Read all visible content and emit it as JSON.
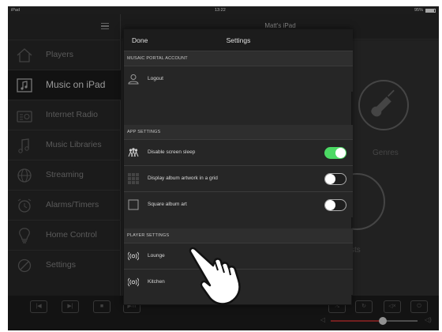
{
  "status_bar": {
    "carrier": "iPad",
    "time": "13:22",
    "battery": "95%"
  },
  "header": {
    "device_title": "Matt's iPad"
  },
  "sidebar": {
    "items": [
      {
        "label": "Players",
        "icon": "house-icon",
        "active": false
      },
      {
        "label": "Music on iPad",
        "icon": "music-note-icon",
        "active": true
      },
      {
        "label": "Internet Radio",
        "icon": "radio-icon",
        "active": false
      },
      {
        "label": "Music Libraries",
        "icon": "music-library-icon",
        "active": false
      },
      {
        "label": "Streaming",
        "icon": "globe-icon",
        "active": false
      },
      {
        "label": "Alarms/Timers",
        "icon": "alarm-clock-icon",
        "active": false
      },
      {
        "label": "Home Control",
        "icon": "lightbulb-icon",
        "active": false
      },
      {
        "label": "Settings",
        "icon": "gear-icon",
        "active": false
      }
    ]
  },
  "content": {
    "tiles": [
      {
        "label": "Genres",
        "icon": "guitar-icon"
      },
      {
        "label": "sts",
        "icon": "house-icon"
      }
    ]
  },
  "settings": {
    "done_label": "Done",
    "title": "Settings",
    "sections": [
      {
        "header": "MUSAIC PORTAL ACCOUNT",
        "rows": [
          {
            "label": "Logout",
            "icon": "user-icon"
          }
        ]
      },
      {
        "header": "APP SETTINGS",
        "rows": [
          {
            "label": "Disable screen sleep",
            "icon": "people-icon",
            "toggle": true
          },
          {
            "label": "Display album artwork in a grid",
            "icon": "grid-icon",
            "toggle": false
          },
          {
            "label": "Square album art",
            "icon": "square-icon",
            "toggle": false
          }
        ]
      },
      {
        "header": "PLAYER SETTINGS",
        "rows": [
          {
            "label": "Lounge",
            "icon": "speaker-icon"
          },
          {
            "label": "Kitchen",
            "icon": "speaker-icon"
          }
        ]
      }
    ]
  },
  "player": {
    "volume": 0.6
  },
  "colors": {
    "toggle_on": "#4cd964",
    "volume_fill": "#b03030",
    "background": "#2b2b2b"
  }
}
